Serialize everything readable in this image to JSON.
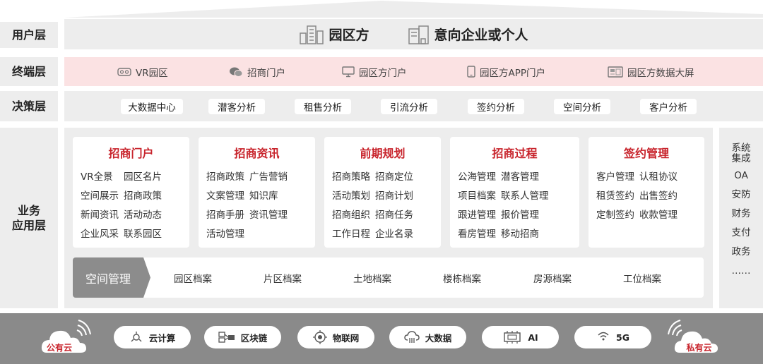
{
  "layers": {
    "user": "用户层",
    "terminal": "终端层",
    "decision": "决策层",
    "business": "业务\n应用层"
  },
  "user_layer": {
    "items": [
      {
        "label": "园区方",
        "icon": "building-icon"
      },
      {
        "label": "意向企业或个人",
        "icon": "office-building-icon"
      }
    ]
  },
  "terminal_layer": {
    "items": [
      {
        "label": "VR园区",
        "icon": "vr-headset-icon"
      },
      {
        "label": "招商门户",
        "icon": "wechat-icon"
      },
      {
        "label": "园区方门户",
        "icon": "desktop-monitor-icon"
      },
      {
        "label": "园区方APP门户",
        "icon": "mobile-phone-icon"
      },
      {
        "label": "园区方数据大屏",
        "icon": "data-screen-icon"
      }
    ]
  },
  "decision_layer": {
    "items": [
      "大数据中心",
      "潜客分析",
      "租售分析",
      "引流分析",
      "签约分析",
      "空间分析",
      "客户分析"
    ]
  },
  "business_layer": {
    "modules": [
      {
        "title": "招商门户",
        "items": [
          "VR全景",
          "园区名片",
          "空间展示",
          "招商政策",
          "新闻资讯",
          "活动动态",
          "企业风采",
          "联系园区"
        ]
      },
      {
        "title": "招商资讯",
        "items": [
          "招商政策",
          "广告营销",
          "文案管理",
          "知识库",
          "招商手册",
          "资讯管理",
          "活动管理"
        ]
      },
      {
        "title": "前期规划",
        "items": [
          "招商策略",
          "招商定位",
          "活动策划",
          "招商计划",
          "招商组织",
          "招商任务",
          "工作日程",
          "企业名录"
        ]
      },
      {
        "title": "招商过程",
        "items": [
          "公海管理",
          "潜客管理",
          "项目档案",
          "联系人管理",
          "跟进管理",
          "报价管理",
          "看房管理",
          "移动招商"
        ]
      },
      {
        "title": "签约管理",
        "items": [
          "客户管理",
          "认租协议",
          "租赁签约",
          "出售签约",
          "定制签约",
          "收款管理"
        ]
      }
    ],
    "space_management": {
      "label": "空间管理",
      "items": [
        "园区档案",
        "片区档案",
        "土地档案",
        "楼栋档案",
        "房源档案",
        "工位档案"
      ]
    },
    "side_panel": [
      "系统\n集成",
      "OA",
      "安防",
      "财务",
      "支付",
      "政务",
      "……"
    ]
  },
  "infrastructure": {
    "public_cloud": "公有云",
    "private_cloud": "私有云",
    "items": [
      {
        "label": "云计算",
        "icon": "cloud-computing-icon"
      },
      {
        "label": "区块链",
        "icon": "blockchain-icon"
      },
      {
        "label": "物联网",
        "icon": "iot-icon"
      },
      {
        "label": "大数据",
        "icon": "big-data-icon"
      },
      {
        "label": "AI",
        "icon": "ai-chip-icon"
      },
      {
        "label": "5G",
        "icon": "5g-signal-icon"
      }
    ]
  },
  "colors": {
    "accent_red": "#c8242c",
    "pink_band": "#fbe2e3",
    "gray_band": "#ededed",
    "infra_gray": "#8a8a8a",
    "space_label_gray": "#8c8c8c"
  }
}
